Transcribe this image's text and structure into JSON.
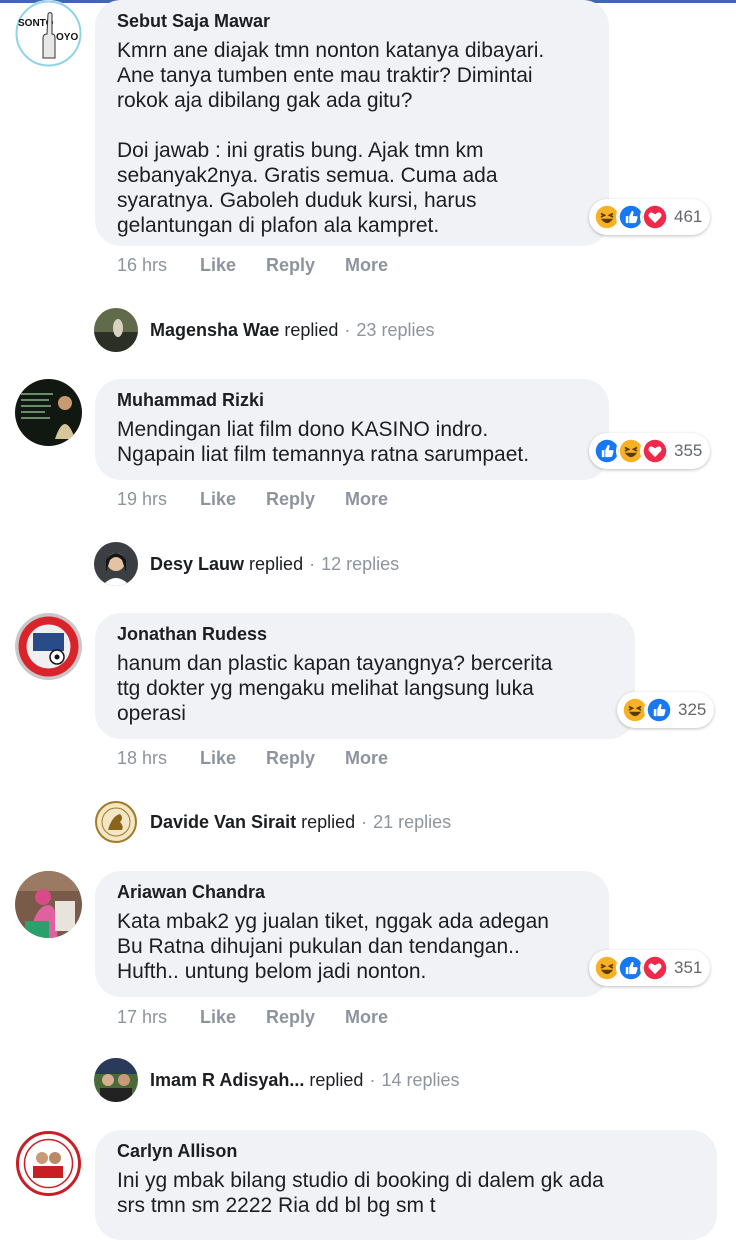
{
  "meta_labels": {
    "like": "Like",
    "reply": "Reply",
    "more": "More",
    "replied": "replied",
    "separator": "·"
  },
  "colors": {
    "bubble": "#f0f2f5",
    "like_blue": "#1877f2",
    "love_red": "#f02849",
    "haha_yellow": "#f7b125",
    "meta_gray": "#8d949e"
  },
  "comments": [
    {
      "author": "Sebut Saja Mawar",
      "avatar_text_left": "SONTO",
      "avatar_text_right": "OYO",
      "text": "Kmrn ane diajak tmn nonton katanya dibayari.\nAne tanya tumben ente mau traktir? Dimintai\nrokok aja dibilang gak ada gitu?\n\nDoi jawab : ini gratis bung. Ajak tmn km\nsebanyak2nya. Gratis semua. Cuma ada\nsyaratnya. Gaboleh duduk kursi, harus\ngelantungan di plafon ala kampret.",
      "time": "16 hrs",
      "reactions": [
        "haha",
        "like",
        "love"
      ],
      "reaction_count": "461",
      "reply": {
        "name": "Magensha Wae",
        "count": "23 replies"
      }
    },
    {
      "author": "Muhammad Rizki",
      "text": "Mendingan liat film dono KASINO indro.\nNgapain liat film temannya ratna sarumpaet.",
      "time": "19 hrs",
      "reactions": [
        "like",
        "haha",
        "love"
      ],
      "reaction_count": "355",
      "reply": {
        "name": "Desy Lauw",
        "count": "12 replies"
      }
    },
    {
      "author": "Jonathan Rudess",
      "text": "hanum dan plastic kapan tayangnya? bercerita\nttg dokter yg mengaku melihat langsung luka\noperasi",
      "time": "18 hrs",
      "reactions": [
        "haha",
        "like"
      ],
      "reaction_count": "325",
      "reply": {
        "name": "Davide Van Sirait",
        "count": "21 replies"
      }
    },
    {
      "author": "Ariawan Chandra",
      "text": "Kata mbak2 yg jualan tiket, nggak ada adegan\nBu Ratna dihujani pukulan dan tendangan..\nHufth.. untung belom jadi nonton.",
      "time": "17 hrs",
      "reactions": [
        "haha",
        "like",
        "love"
      ],
      "reaction_count": "351",
      "reply": {
        "name": "Imam R Adisyah...",
        "count": "14 replies"
      }
    },
    {
      "author": "Carlyn Allison",
      "text": "Ini yg mbak bilang studio di booking di dalem gk ada\nsrs tmn sm 2222 Ria dd bl bg sm t"
    }
  ]
}
